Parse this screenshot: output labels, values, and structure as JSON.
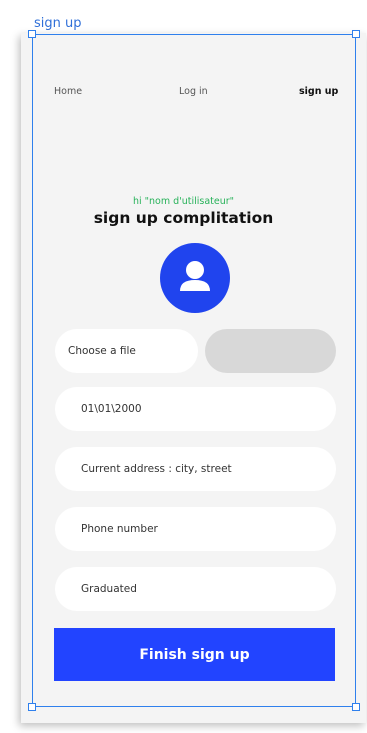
{
  "frame": {
    "label": "sign up"
  },
  "nav": {
    "home": "Home",
    "login": "Log in",
    "signup": "sign up"
  },
  "header": {
    "greeting": "hi \"nom d'utilisateur\"",
    "title": "sign up complitation"
  },
  "avatar": {
    "icon": "user-icon"
  },
  "form": {
    "file_label": "Choose a file",
    "birthdate": "01\\01\\2000",
    "address_placeholder": "Current address : city, street",
    "phone_placeholder": "Phone number",
    "graduated_placeholder": "Graduated"
  },
  "actions": {
    "finish_label": "Finish sign up"
  },
  "colors": {
    "accent": "#2244ff",
    "greeting": "#28b25a",
    "selection": "#2f80ed",
    "background": "#f4f4f4"
  }
}
